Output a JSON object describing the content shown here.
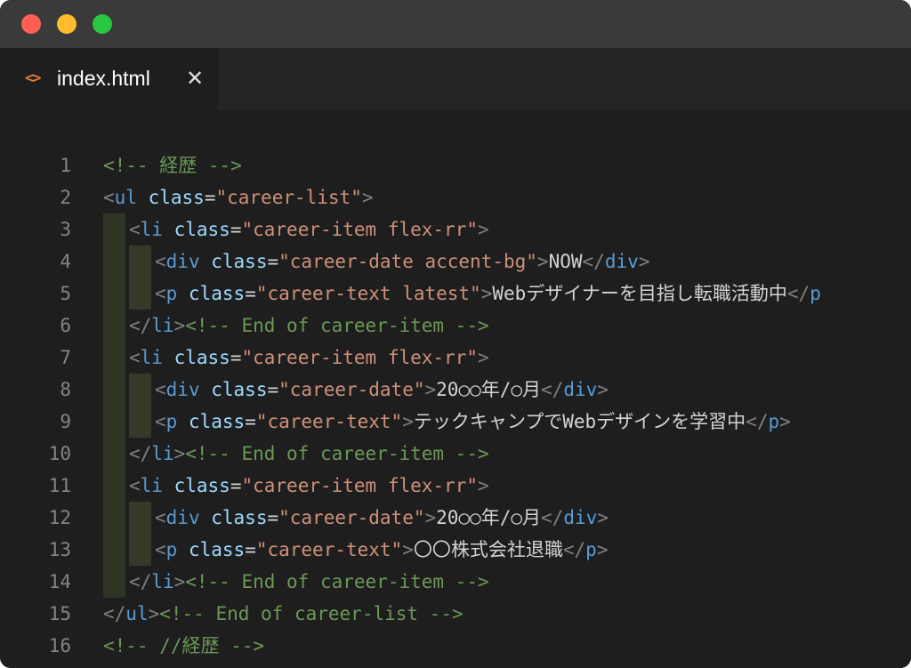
{
  "window": {
    "controls": [
      "close",
      "minimize",
      "maximize"
    ],
    "colors": {
      "close": "#fe5f57",
      "minimize": "#febc2e",
      "maximize": "#28c840"
    }
  },
  "tab": {
    "icon": "html-code-icon",
    "filename": "index.html",
    "close_glyph": "✕"
  },
  "editor": {
    "lines": [
      {
        "n": "1",
        "indent": 0,
        "tokens": [
          [
            "c-com",
            "<!-- 経歴 -->"
          ]
        ]
      },
      {
        "n": "2",
        "indent": 0,
        "tokens": [
          [
            "c-punc",
            "<"
          ],
          [
            "c-tag",
            "ul"
          ],
          [
            "c-txt",
            " "
          ],
          [
            "c-attr",
            "class"
          ],
          [
            "c-txt",
            "="
          ],
          [
            "c-str",
            "\"career-list\""
          ],
          [
            "c-punc",
            ">"
          ]
        ]
      },
      {
        "n": "3",
        "indent": 1,
        "tokens": [
          [
            "c-punc",
            "<"
          ],
          [
            "c-tag",
            "li"
          ],
          [
            "c-txt",
            " "
          ],
          [
            "c-attr",
            "class"
          ],
          [
            "c-txt",
            "="
          ],
          [
            "c-str",
            "\"career-item flex-rr\""
          ],
          [
            "c-punc",
            ">"
          ]
        ]
      },
      {
        "n": "4",
        "indent": 2,
        "tokens": [
          [
            "c-punc",
            "<"
          ],
          [
            "c-tag",
            "div"
          ],
          [
            "c-txt",
            " "
          ],
          [
            "c-attr",
            "class"
          ],
          [
            "c-txt",
            "="
          ],
          [
            "c-str",
            "\"career-date accent-bg\""
          ],
          [
            "c-punc",
            ">"
          ],
          [
            "c-txt",
            "NOW"
          ],
          [
            "c-punc",
            "</"
          ],
          [
            "c-tag",
            "div"
          ],
          [
            "c-punc",
            ">"
          ]
        ]
      },
      {
        "n": "5",
        "indent": 2,
        "tokens": [
          [
            "c-punc",
            "<"
          ],
          [
            "c-tag",
            "p"
          ],
          [
            "c-txt",
            " "
          ],
          [
            "c-attr",
            "class"
          ],
          [
            "c-txt",
            "="
          ],
          [
            "c-str",
            "\"career-text latest\""
          ],
          [
            "c-punc",
            ">"
          ],
          [
            "c-txt",
            "Webデザイナーを目指し転職活動中"
          ],
          [
            "c-punc",
            "</"
          ],
          [
            "c-tag",
            "p"
          ]
        ]
      },
      {
        "n": "6",
        "indent": 1,
        "tokens": [
          [
            "c-punc",
            "</"
          ],
          [
            "c-tag",
            "li"
          ],
          [
            "c-punc",
            ">"
          ],
          [
            "c-com",
            "<!-- End of career-item -->"
          ]
        ]
      },
      {
        "n": "7",
        "indent": 1,
        "tokens": [
          [
            "c-punc",
            "<"
          ],
          [
            "c-tag",
            "li"
          ],
          [
            "c-txt",
            " "
          ],
          [
            "c-attr",
            "class"
          ],
          [
            "c-txt",
            "="
          ],
          [
            "c-str",
            "\"career-item flex-rr\""
          ],
          [
            "c-punc",
            ">"
          ]
        ]
      },
      {
        "n": "8",
        "indent": 2,
        "tokens": [
          [
            "c-punc",
            "<"
          ],
          [
            "c-tag",
            "div"
          ],
          [
            "c-txt",
            " "
          ],
          [
            "c-attr",
            "class"
          ],
          [
            "c-txt",
            "="
          ],
          [
            "c-str",
            "\"career-date\""
          ],
          [
            "c-punc",
            ">"
          ],
          [
            "c-txt",
            "20○○年/○月"
          ],
          [
            "c-punc",
            "</"
          ],
          [
            "c-tag",
            "div"
          ],
          [
            "c-punc",
            ">"
          ]
        ]
      },
      {
        "n": "9",
        "indent": 2,
        "tokens": [
          [
            "c-punc",
            "<"
          ],
          [
            "c-tag",
            "p"
          ],
          [
            "c-txt",
            " "
          ],
          [
            "c-attr",
            "class"
          ],
          [
            "c-txt",
            "="
          ],
          [
            "c-str",
            "\"career-text\""
          ],
          [
            "c-punc",
            ">"
          ],
          [
            "c-txt",
            "テックキャンプでWebデザインを学習中"
          ],
          [
            "c-punc",
            "</"
          ],
          [
            "c-tag",
            "p"
          ],
          [
            "c-punc",
            ">"
          ]
        ]
      },
      {
        "n": "10",
        "indent": 1,
        "tokens": [
          [
            "c-punc",
            "</"
          ],
          [
            "c-tag",
            "li"
          ],
          [
            "c-punc",
            ">"
          ],
          [
            "c-com",
            "<!-- End of career-item -->"
          ]
        ]
      },
      {
        "n": "11",
        "indent": 1,
        "tokens": [
          [
            "c-punc",
            "<"
          ],
          [
            "c-tag",
            "li"
          ],
          [
            "c-txt",
            " "
          ],
          [
            "c-attr",
            "class"
          ],
          [
            "c-txt",
            "="
          ],
          [
            "c-str",
            "\"career-item flex-rr\""
          ],
          [
            "c-punc",
            ">"
          ]
        ]
      },
      {
        "n": "12",
        "indent": 2,
        "tokens": [
          [
            "c-punc",
            "<"
          ],
          [
            "c-tag",
            "div"
          ],
          [
            "c-txt",
            " "
          ],
          [
            "c-attr",
            "class"
          ],
          [
            "c-txt",
            "="
          ],
          [
            "c-str",
            "\"career-date\""
          ],
          [
            "c-punc",
            ">"
          ],
          [
            "c-txt",
            "20○○年/○月"
          ],
          [
            "c-punc",
            "</"
          ],
          [
            "c-tag",
            "div"
          ],
          [
            "c-punc",
            ">"
          ]
        ]
      },
      {
        "n": "13",
        "indent": 2,
        "tokens": [
          [
            "c-punc",
            "<"
          ],
          [
            "c-tag",
            "p"
          ],
          [
            "c-txt",
            " "
          ],
          [
            "c-attr",
            "class"
          ],
          [
            "c-txt",
            "="
          ],
          [
            "c-str",
            "\"career-text\""
          ],
          [
            "c-punc",
            ">"
          ],
          [
            "c-txt",
            "〇〇株式会社退職"
          ],
          [
            "c-punc",
            "</"
          ],
          [
            "c-tag",
            "p"
          ],
          [
            "c-punc",
            ">"
          ]
        ]
      },
      {
        "n": "14",
        "indent": 1,
        "tokens": [
          [
            "c-punc",
            "</"
          ],
          [
            "c-tag",
            "li"
          ],
          [
            "c-punc",
            ">"
          ],
          [
            "c-com",
            "<!-- End of career-item -->"
          ]
        ]
      },
      {
        "n": "15",
        "indent": 0,
        "tokens": [
          [
            "c-punc",
            "</"
          ],
          [
            "c-tag",
            "ul"
          ],
          [
            "c-punc",
            ">"
          ],
          [
            "c-com",
            "<!-- End of career-list -->"
          ]
        ]
      },
      {
        "n": "16",
        "indent": 0,
        "tokens": [
          [
            "c-com",
            "<!-- //経歴 -->"
          ]
        ]
      }
    ]
  }
}
